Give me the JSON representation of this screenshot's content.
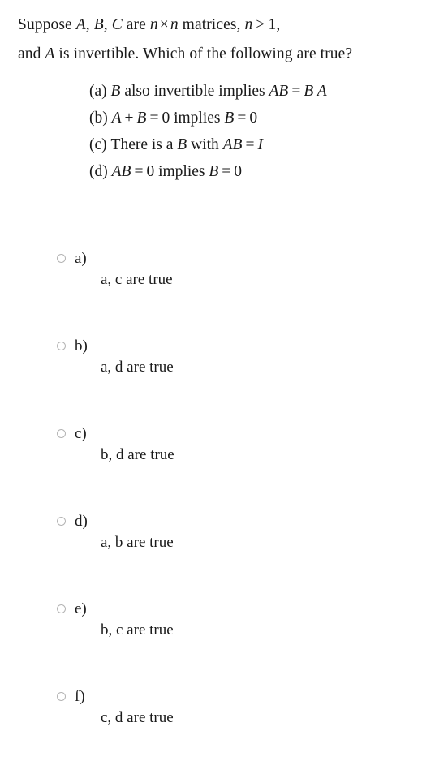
{
  "question": {
    "stem_lines": [
      "Suppose A, B, C are n × n matrices, n > 1,",
      "and A is invertible. Which of the following are true?"
    ],
    "stem_line1": {
      "t1": "Suppose ",
      "varA": "A",
      "c1": ", ",
      "varB": "B",
      "c2": ", ",
      "varC": "C",
      "t2": " are ",
      "varN1": "n",
      "times": "×",
      "varN2": "n",
      "t3": " matrices, ",
      "varN3": "n",
      "gt": ">",
      "one": "1",
      "t4": ","
    },
    "stem_line2": {
      "t1": "and ",
      "varA": "A",
      "t2": " is invertible. Which of the following are true?"
    },
    "statements": [
      {
        "tag": "(a)",
        "text": "(a) B also invertible implies AB = B A",
        "parts": {
          "varB": "B",
          "t1": " also invertible implies ",
          "lhs": "AB",
          "eq": "=",
          "rhs": "B A"
        }
      },
      {
        "tag": "(b)",
        "text": "(b) A + B = 0 implies B = 0",
        "parts": {
          "varA": "A",
          "plus": "+",
          "varB": "B",
          "eq1": "=",
          "zero1": "0",
          "t1": " implies ",
          "varB2": "B",
          "eq2": "=",
          "zero2": "0"
        }
      },
      {
        "tag": "(c)",
        "text": "(c) There is a B with AB = I",
        "parts": {
          "t1": "There is a ",
          "varB": "B",
          "t2": " with ",
          "lhs": "AB",
          "eq": "=",
          "varI": "I"
        }
      },
      {
        "tag": "(d)",
        "text": "(d) AB = 0 implies B = 0",
        "parts": {
          "lhs": "AB",
          "eq1": "=",
          "zero1": "0",
          "t1": " implies ",
          "varB": "B",
          "eq2": "=",
          "zero2": "0"
        }
      }
    ]
  },
  "choices": [
    {
      "letter": "a)",
      "text": "a, c are true",
      "selected": false
    },
    {
      "letter": "b)",
      "text": "a, d are true",
      "selected": false
    },
    {
      "letter": "c)",
      "text": "b, d are true",
      "selected": false
    },
    {
      "letter": "d)",
      "text": "a, b are true",
      "selected": false
    },
    {
      "letter": "e)",
      "text": "b, c are true",
      "selected": false
    },
    {
      "letter": "f)",
      "text": "c, d are true",
      "selected": false
    }
  ],
  "colors": {
    "background": "#ffffff",
    "text": "#1a1a1a",
    "radio_border": "#b4b4b4"
  }
}
